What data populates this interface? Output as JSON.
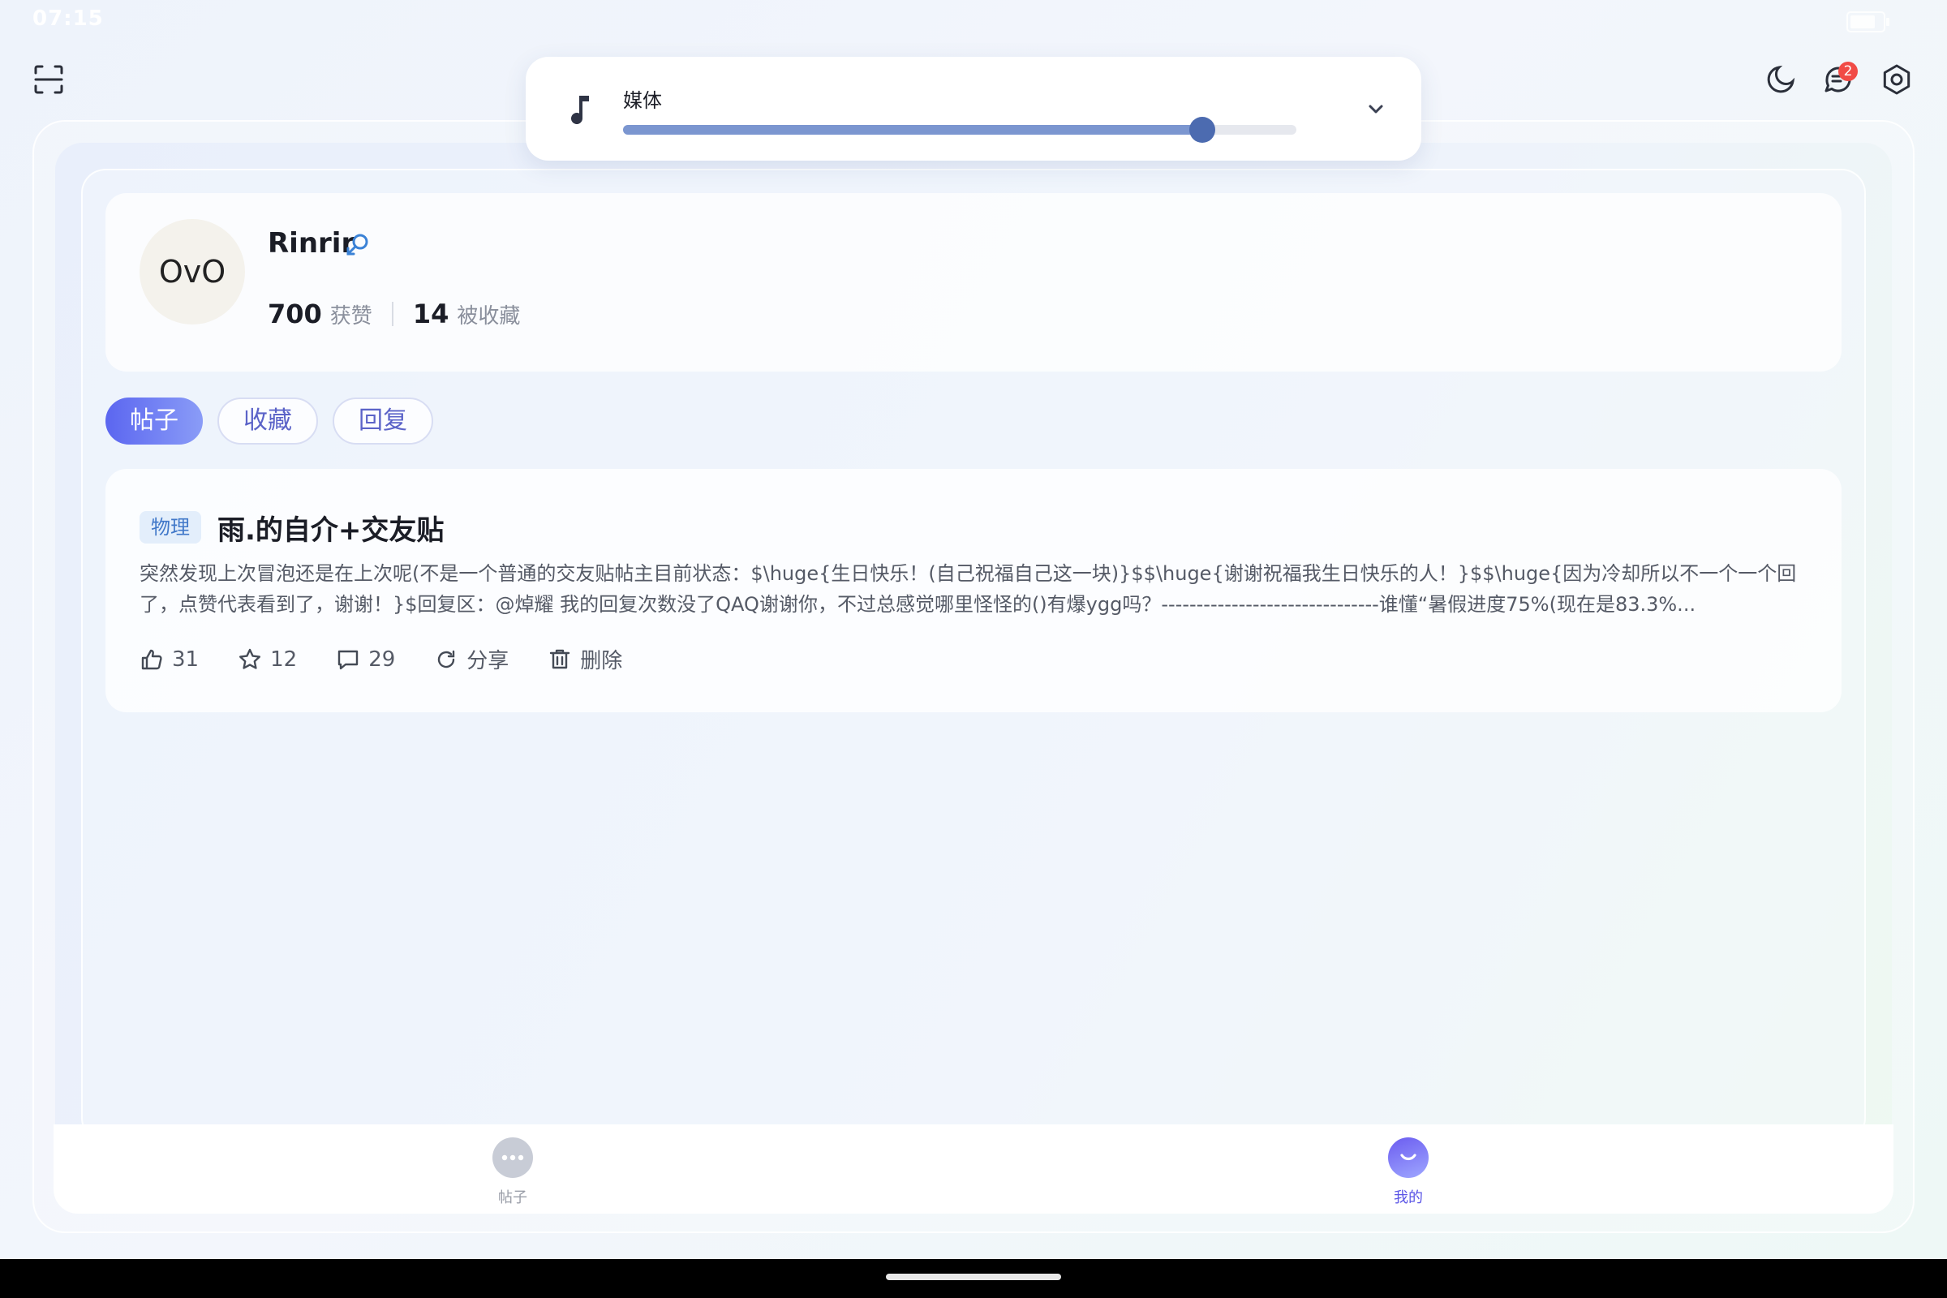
{
  "status_bar": {
    "time": "07:15"
  },
  "header": {
    "message_badge": "2"
  },
  "media_panel": {
    "label": "媒体",
    "volume_percent": 86
  },
  "profile": {
    "avatar_text": "OvO",
    "username": "Rinrir",
    "stats": [
      {
        "value": "700",
        "label": "获赞"
      },
      {
        "value": "14",
        "label": "被收藏"
      }
    ]
  },
  "tabs": [
    {
      "label": "帖子",
      "active": true
    },
    {
      "label": "收藏",
      "active": false
    },
    {
      "label": "回复",
      "active": false
    }
  ],
  "post": {
    "tag": "物理",
    "title": "雨.的自介+交友贴",
    "body": "突然发现上次冒泡还是在上次呢(不是一个普通的交友贴帖主目前状态：$\\huge{生日快乐！(自己祝福自己这一块)}$$\\huge{谢谢祝福我生日快乐的人！}$$\\huge{因为冷却所以不一个一个回了，点赞代表看到了，谢谢！}$回复区：@焯耀 我的回复次数没了QAQ谢谢你，不过总感觉哪里怪怪的()有爆ygg吗？-------------------------------谁懂“暑假进度75%(现在是83.3%...",
    "likes": "31",
    "stars": "12",
    "comments": "29",
    "share_label": "分享",
    "delete_label": "删除"
  },
  "bottom_nav": [
    {
      "label": "帖子",
      "active": false
    },
    {
      "label": "我的",
      "active": true
    }
  ],
  "colors": {
    "accent": "#5b66f0",
    "slider_thumb": "#4c6bb0",
    "badge": "#f14b46",
    "tag_text": "#4178c9"
  }
}
